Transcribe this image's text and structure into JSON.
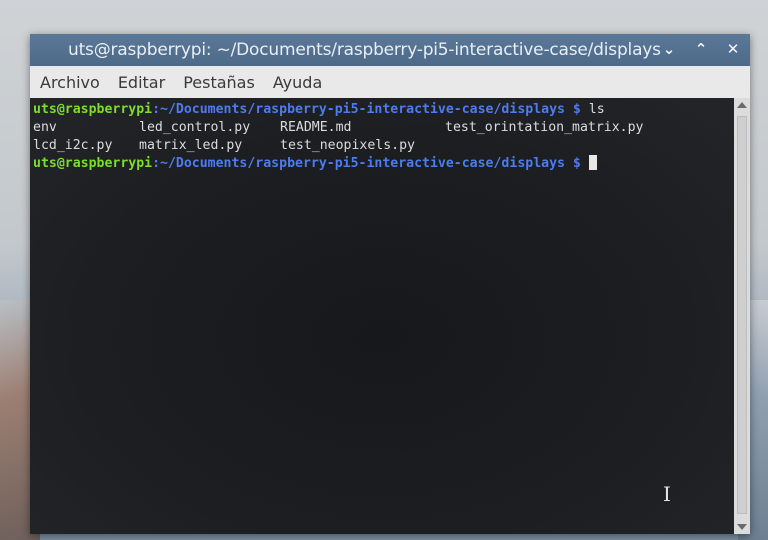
{
  "window": {
    "title": "uts@raspberrypi: ~/Documents/raspberry-pi5-interactive-case/displays"
  },
  "menu": [
    "Archivo",
    "Editar",
    "Pestañas",
    "Ayuda"
  ],
  "terminal": {
    "prompt_user": "uts@raspberrypi",
    "prompt_path": ":~/Documents/raspberry-pi5-interactive-case/displays $",
    "command": "ls",
    "listing_row1": [
      "env",
      "led_control.py",
      "README.md",
      "test_orintation_matrix.py"
    ],
    "listing_row2": [
      "lcd_i2c.py",
      "matrix_led.py",
      "test_neopixels.py"
    ]
  },
  "icons": {
    "minimize": "chevron-down-icon",
    "maximize": "chevron-up-icon",
    "close": "close-icon"
  },
  "colors": {
    "titlebar": "#5b7898",
    "prompt_user": "#7cde2a",
    "prompt_path": "#4d7cf0",
    "terminal_bg": "#1c1e21"
  }
}
